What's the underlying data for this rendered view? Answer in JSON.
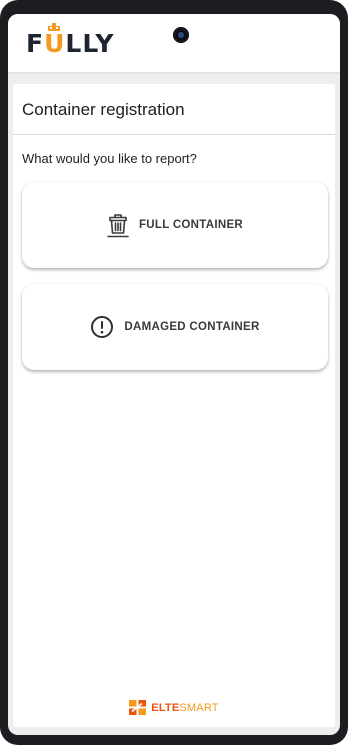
{
  "app": {
    "logo_prefix": "F",
    "logo_accent": "U",
    "logo_suffix": "LLY",
    "accent_color": "#f39a1e",
    "dark_color": "#1e2430"
  },
  "page": {
    "title": "Container registration",
    "question": "What would you like to report?"
  },
  "options": [
    {
      "label": "FULL CONTAINER",
      "icon": "trash-bin-icon"
    },
    {
      "label": "DAMAGED CONTAINER",
      "icon": "alert-circle-icon"
    }
  ],
  "footer": {
    "brand_part1": "ELTE",
    "brand_part2": "SMART",
    "brand_color_1": "#e9540e",
    "brand_color_2": "#f39a1e"
  }
}
